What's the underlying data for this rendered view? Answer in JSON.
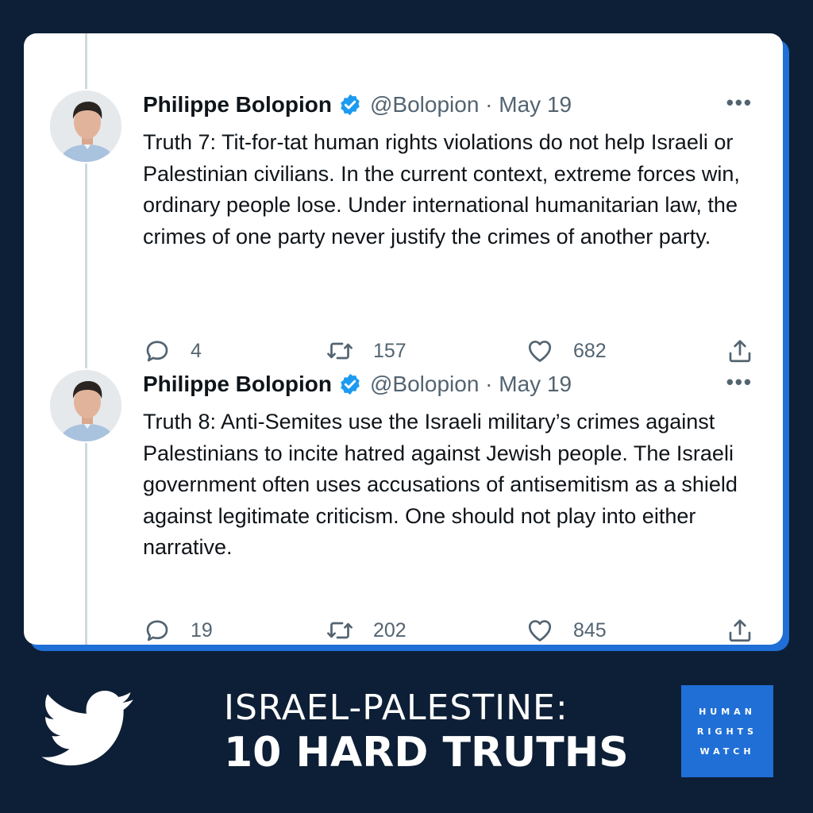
{
  "colors": {
    "background": "#0d1f36",
    "card": "#ffffff",
    "accent_blue": "#1f6fd6",
    "verified_blue": "#1d9bf0",
    "secondary_text": "#536471"
  },
  "tweets": [
    {
      "name": "Philippe Bolopion",
      "handle_date": "@Bolopion · May 19",
      "text": "Truth 7: Tit-for-tat human rights violations do not help Israeli or Palestinian civilians. In the current context, extreme forces win, ordinary people lose. Under international humanitarian law, the crimes of one party never justify the crimes of another party.",
      "replies": "4",
      "retweets": "157",
      "likes": "682",
      "more": "•••"
    },
    {
      "name": "Philippe Bolopion",
      "handle_date": "@Bolopion · May 19",
      "text": "Truth 8: Anti-Semites use the Israeli military’s crimes against Palestinians to incite hatred against Jewish people. The Israeli government often uses accusations of antisemitism as a shield against legitimate criticism. One should not play into either narrative.",
      "replies": "19",
      "retweets": "202",
      "likes": "845",
      "more": "•••"
    }
  ],
  "icons": {
    "verified": "verified-badge-icon",
    "reply": "reply-bubble-icon",
    "retweet": "retweet-arrows-icon",
    "like": "heart-icon",
    "share": "share-upload-icon",
    "footer": "twitter-bird-icon"
  },
  "footer": {
    "title_line1": "ISRAEL-PALESTINE:",
    "title_line2": "10 HARD TRUTHS",
    "logo_line1": "HUMAN",
    "logo_line2": "RIGHTS",
    "logo_line3": "WATCH"
  }
}
